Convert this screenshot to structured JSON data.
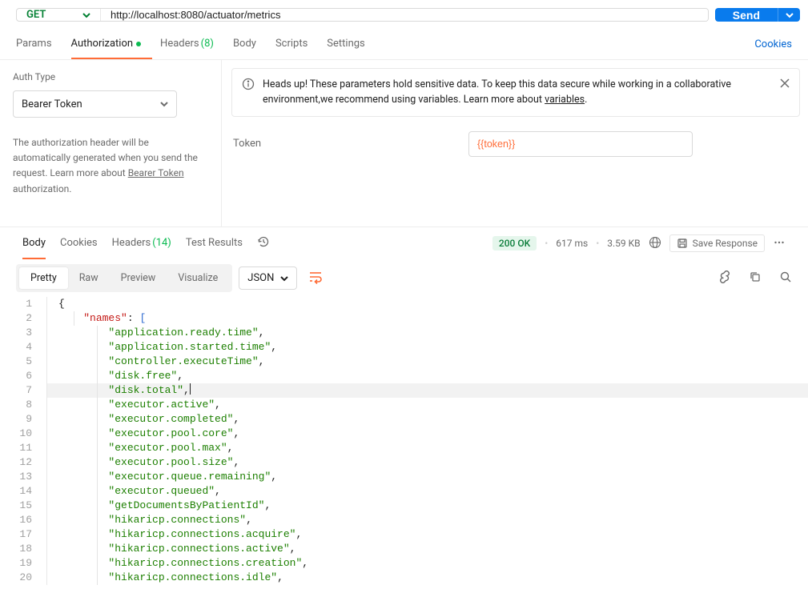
{
  "request": {
    "method": "GET",
    "url": "http://localhost:8080/actuator/metrics",
    "send_label": "Send"
  },
  "req_tabs": {
    "params": "Params",
    "authorization": "Authorization",
    "headers": "Headers",
    "headers_count": "(8)",
    "body": "Body",
    "scripts": "Scripts",
    "settings": "Settings",
    "cookies": "Cookies"
  },
  "auth": {
    "type_label": "Auth Type",
    "type_value": "Bearer Token",
    "desc_1": "The authorization header will be automatically generated when you send the request. Learn more about ",
    "desc_link": "Bearer Token",
    "desc_2": " authorization.",
    "info": "Heads up! These parameters hold sensitive data. To keep this data secure while working in a collaborative environment,we recommend using variables. Learn more about ",
    "info_link": "variables",
    "info_period": ".",
    "token_label": "Token",
    "token_value": "{{token}}"
  },
  "resp_tabs": {
    "body": "Body",
    "cookies": "Cookies",
    "headers": "Headers",
    "headers_count": "(14)",
    "test_results": "Test Results"
  },
  "status": {
    "code": "200 OK",
    "time": "617 ms",
    "size": "3.59 KB",
    "save": "Save Response"
  },
  "body_controls": {
    "pretty": "Pretty",
    "raw": "Raw",
    "preview": "Preview",
    "visualize": "Visualize",
    "format": "JSON"
  },
  "code": {
    "key_names": "\"names\"",
    "lines": [
      "application.ready.time",
      "application.started.time",
      "controller.executeTime",
      "disk.free",
      "disk.total",
      "executor.active",
      "executor.completed",
      "executor.pool.core",
      "executor.pool.max",
      "executor.pool.size",
      "executor.queue.remaining",
      "executor.queued",
      "getDocumentsByPatientId",
      "hikaricp.connections",
      "hikaricp.connections.acquire",
      "hikaricp.connections.active",
      "hikaricp.connections.creation",
      "hikaricp.connections.idle"
    ]
  }
}
